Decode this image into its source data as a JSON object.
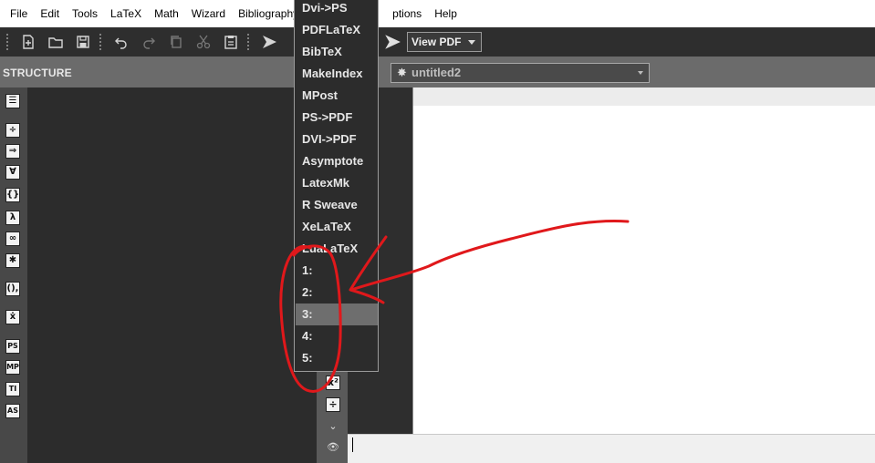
{
  "menubar": {
    "file": "File",
    "edit": "Edit",
    "tools": "Tools",
    "latex": "LaTeX",
    "math": "Math",
    "wizard": "Wizard",
    "bibliography": "Bibliography",
    "options": "ptions",
    "help": "Help"
  },
  "toolbar": {
    "view_pdf_label": "View PDF"
  },
  "structure": {
    "title": "STRUCTURE"
  },
  "document": {
    "name": "untitled2"
  },
  "left_sidebar": {
    "ps_label": "PS",
    "mp_label": "MP",
    "ti_label": "TI",
    "as_label": "AS"
  },
  "dropdown": {
    "items": [
      "Dvi->PS",
      "PDFLaTeX",
      "BibTeX",
      "MakeIndex",
      "MPost",
      "PS->PDF",
      "DVI->PDF",
      "Asymptote",
      "LatexMk",
      "R Sweave",
      "XeLaTeX",
      "LuaLaTeX",
      "1:",
      "2:",
      "3:",
      "4:",
      "5:"
    ],
    "highlighted_index": 14
  },
  "colors": {
    "annotation": "#e0181b",
    "toolbar_bg": "#2e2e2e",
    "menu_highlight": "#6e6e6e"
  }
}
